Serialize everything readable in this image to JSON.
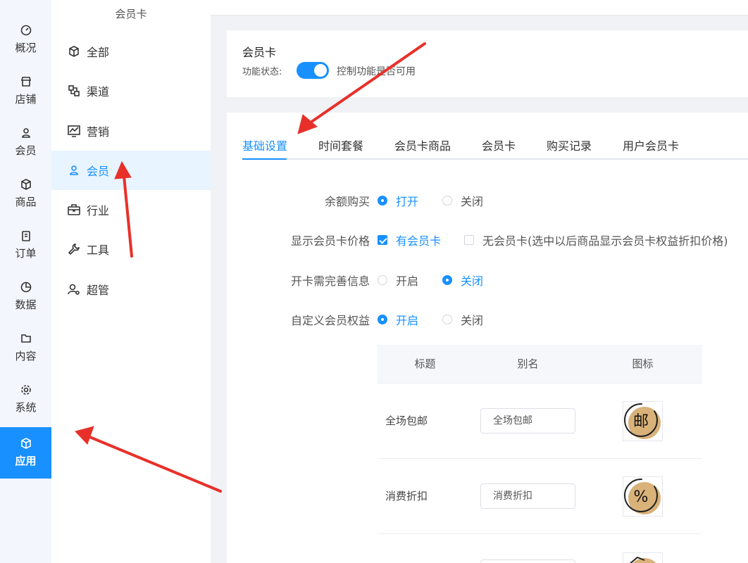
{
  "nav": {
    "items": [
      {
        "label": "概况",
        "icon": "dashboard-icon"
      },
      {
        "label": "店铺",
        "icon": "store-icon"
      },
      {
        "label": "会员",
        "icon": "user-icon"
      },
      {
        "label": "商品",
        "icon": "box-icon"
      },
      {
        "label": "订单",
        "icon": "clipboard-icon"
      },
      {
        "label": "数据",
        "icon": "pie-icon"
      },
      {
        "label": "内容",
        "icon": "folder-icon"
      },
      {
        "label": "系统",
        "icon": "gear-icon"
      },
      {
        "label": "应用",
        "icon": "cube-icon"
      }
    ]
  },
  "submenu": {
    "title": "会员卡",
    "items": [
      {
        "label": "全部"
      },
      {
        "label": "渠道"
      },
      {
        "label": "营销"
      },
      {
        "label": "会员"
      },
      {
        "label": "行业"
      },
      {
        "label": "工具"
      },
      {
        "label": "超管"
      }
    ]
  },
  "header": {
    "title": "会员卡",
    "status_label": "功能状态:",
    "status_on": true,
    "status_desc": "控制功能是否可用"
  },
  "tabs": [
    "基础设置",
    "时间套餐",
    "会员卡商品",
    "会员卡",
    "购买记录",
    "用户会员卡"
  ],
  "settings": {
    "balance": {
      "label": "余额购买",
      "opt1": "打开",
      "opt2": "关闭"
    },
    "price": {
      "label": "显示会员卡价格",
      "opt1": "有会员卡",
      "opt2": "无会员卡(选中以后商品显示会员卡权益折扣价格)"
    },
    "info": {
      "label": "开卡需完善信息",
      "opt1": "开启",
      "opt2": "关闭"
    },
    "custom": {
      "label": "自定义会员权益",
      "opt1": "开启",
      "opt2": "关闭"
    }
  },
  "table": {
    "headers": [
      "标题",
      "别名",
      "图标"
    ],
    "rows": [
      {
        "title": "全场包邮",
        "alias": "全场包邮",
        "glyph": "邮"
      },
      {
        "title": "消费折扣",
        "alias": "消费折扣",
        "glyph": "%"
      }
    ]
  },
  "colors": {
    "accent": "#1890ff",
    "icon_gold": "#d9b27a"
  }
}
